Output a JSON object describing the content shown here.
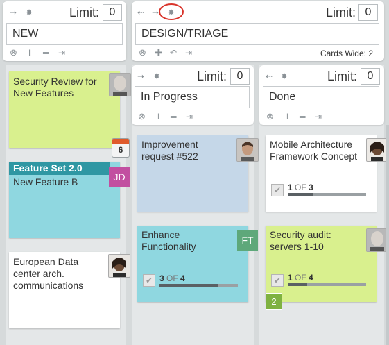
{
  "limit_label": "Limit:",
  "lanes": {
    "new": {
      "name": "NEW",
      "limit": "0"
    },
    "design": {
      "name": "DESIGN/TRIAGE",
      "limit": "0",
      "cards_wide": "Cards Wide: 2"
    },
    "inprogress": {
      "name": "In Progress",
      "limit": "0"
    },
    "done": {
      "name": "Done",
      "limit": "0"
    }
  },
  "cards": {
    "c1": {
      "title": "Security Review for New Features",
      "date_badge": "6",
      "color": "#d9f08e"
    },
    "c2": {
      "header": "Feature Set 2.0",
      "title": "New Feature B",
      "initials": "JD",
      "color": "#8fd7e0"
    },
    "c3": {
      "title": "European Data center arch. communications",
      "color": "#ffffff"
    },
    "c4": {
      "title": "Improvement request #522",
      "color": "#c5d7e8"
    },
    "c5": {
      "title": "Enhance Functionality",
      "initials": "FT",
      "done": "3",
      "of": "OF",
      "total": "4",
      "progress": 0.75,
      "color": "#8fd7e0"
    },
    "c6": {
      "title": "Mobile Architecture Framework Concept",
      "done": "1",
      "of": "OF",
      "total": "3",
      "progress": 0.33,
      "color": "#ffffff"
    },
    "c7": {
      "title": "Security audit: servers 1-10",
      "done": "1",
      "of": "OF",
      "total": "4",
      "progress": 0.25,
      "count_badge": "2",
      "color": "#d9f08e"
    }
  },
  "colors": {
    "highlight": "#d9342b",
    "jd": "#c24fa0",
    "ft": "#5ea87a",
    "count_badge": "#7fb241"
  }
}
